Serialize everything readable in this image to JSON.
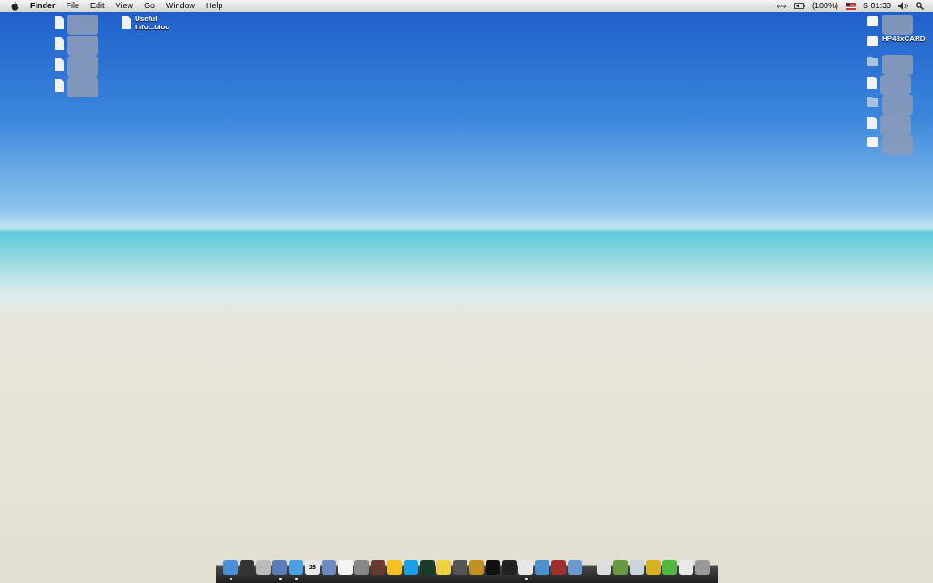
{
  "menu_bar": {
    "items": [
      {
        "label": "Finder",
        "kind": "app"
      },
      {
        "label": "File",
        "kind": "menu"
      },
      {
        "label": "Edit",
        "kind": "menu"
      },
      {
        "label": "View",
        "kind": "menu"
      },
      {
        "label": "Go",
        "kind": "menu"
      },
      {
        "label": "Window",
        "kind": "menu"
      },
      {
        "label": "Help",
        "kind": "menu"
      }
    ],
    "battery": "(100%)",
    "clock": "S 01:33"
  },
  "desktop_left": [
    {
      "kind": "document",
      "redacted": true
    },
    {
      "kind": "document",
      "redacted": true
    },
    {
      "kind": "document",
      "redacted": true
    },
    {
      "kind": "document",
      "redacted": true
    }
  ],
  "desktop_left_2": [
    {
      "kind": "document",
      "redacted": false,
      "label": "Useful Info...bloc"
    }
  ],
  "desktop_right": [
    {
      "kind": "disk",
      "redacted": true
    },
    {
      "kind": "disk",
      "redacted": false,
      "label": "HP43xCARD"
    },
    {
      "kind": "folder",
      "redacted": true
    },
    {
      "kind": "document",
      "redacted": true
    },
    {
      "kind": "folder",
      "redacted": true
    },
    {
      "kind": "document",
      "redacted": true
    },
    {
      "kind": "disk",
      "redacted": true
    }
  ],
  "dock": {
    "apps": [
      {
        "running": true
      },
      {
        "running": false
      },
      {
        "running": false
      },
      {
        "running": true
      },
      {
        "running": true
      },
      {
        "running": false,
        "label": "25"
      },
      {
        "running": false
      },
      {
        "running": false
      },
      {
        "running": false
      },
      {
        "running": false
      },
      {
        "running": false
      },
      {
        "running": false
      },
      {
        "running": false
      },
      {
        "running": false
      },
      {
        "running": false
      },
      {
        "running": false
      },
      {
        "running": false
      },
      {
        "running": false
      },
      {
        "running": true
      },
      {
        "running": false
      },
      {
        "running": false
      },
      {
        "running": false
      }
    ],
    "others": [
      {
        "running": false
      },
      {
        "running": false
      },
      {
        "running": false
      },
      {
        "running": false
      },
      {
        "running": false
      },
      {
        "running": false
      },
      {
        "running": false
      }
    ]
  }
}
